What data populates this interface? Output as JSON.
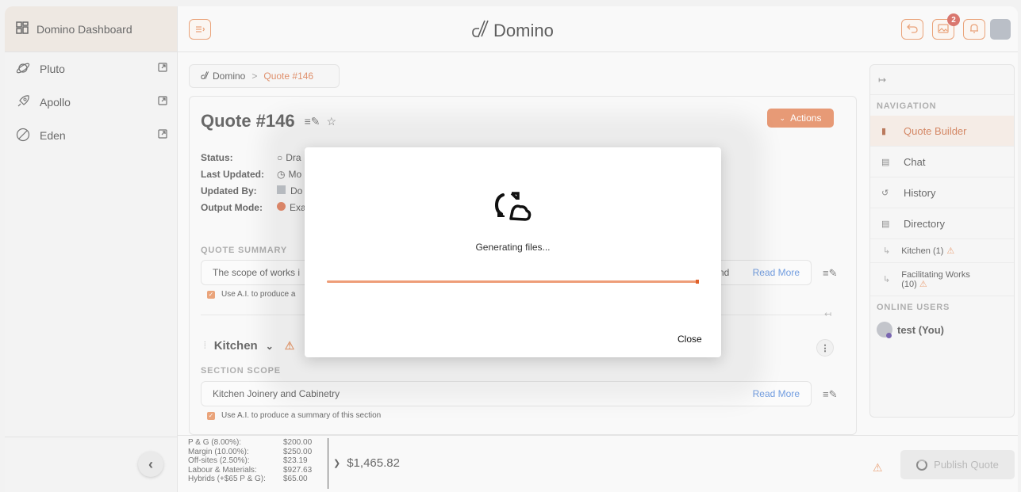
{
  "sidebar": {
    "header_label": "Domino Dashboard",
    "items": [
      {
        "label": "Pluto",
        "icon": "planet-icon"
      },
      {
        "label": "Apollo",
        "icon": "rocket-icon"
      },
      {
        "label": "Eden",
        "icon": "circle-slash-icon"
      }
    ],
    "collapse_glyph": "‹"
  },
  "topbar": {
    "brand": "Domino",
    "notification_count": "2"
  },
  "breadcrumb": {
    "root": "Domino",
    "separator": ">",
    "current": "Quote #146"
  },
  "quote": {
    "title": "Quote #146",
    "actions_label": "Actions",
    "status_label": "Status:",
    "status_value": "Dra",
    "last_updated_label": "Last Updated:",
    "last_updated_value": "Mo",
    "updated_by_label": "Updated By:",
    "updated_by_value": "Do",
    "output_mode_label": "Output Mode:",
    "output_mode_value": "Exa",
    "summary_heading": "QUOTE SUMMARY",
    "summary_text_start": "The scope of works i",
    "summary_text_end": "nd",
    "read_more": "Read More",
    "ai_checkbox_partial": "Use A.I. to produce a"
  },
  "kitchen": {
    "title": "Kitchen",
    "scope_heading": "SECTION SCOPE",
    "scope_text": "Kitchen Joinery and Cabinetry",
    "read_more": "Read More",
    "ai_checkbox": "Use A.I. to produce a summary of this section"
  },
  "right_panel": {
    "navigation_heading": "NAVIGATION",
    "nav_items": [
      {
        "label": "Quote Builder",
        "icon": "document-icon",
        "active": true
      },
      {
        "label": "Chat",
        "icon": "chat-icon",
        "active": false
      },
      {
        "label": "History",
        "icon": "history-icon",
        "active": false
      },
      {
        "label": "Directory",
        "icon": "directory-icon",
        "active": false
      }
    ],
    "sections": [
      {
        "label": "Kitchen (1)"
      },
      {
        "label_line1": "Facilitating Works",
        "label_line2": "(10)"
      }
    ],
    "online_heading": "ONLINE USERS",
    "user": "test (You)"
  },
  "footer": {
    "costs": [
      {
        "label": "P & G (8.00%):",
        "value": "$200.00"
      },
      {
        "label": "Margin (10.00%):",
        "value": "$250.00"
      },
      {
        "label": "Off-sites (2.50%):",
        "value": "$23.19"
      },
      {
        "label": "Labour & Materials:",
        "value": "$927.63"
      },
      {
        "label": "Hybrids (+$65 P & G):",
        "value": "$65.00"
      }
    ],
    "total": "$1,465.82",
    "publish_label": "Publish Quote"
  },
  "modal": {
    "message": "Generating files...",
    "progress": 0.997,
    "close_label": "Close"
  },
  "colors": {
    "accent": "#dc6a35",
    "link": "#2f6fd1",
    "warning": "#e0793d"
  }
}
